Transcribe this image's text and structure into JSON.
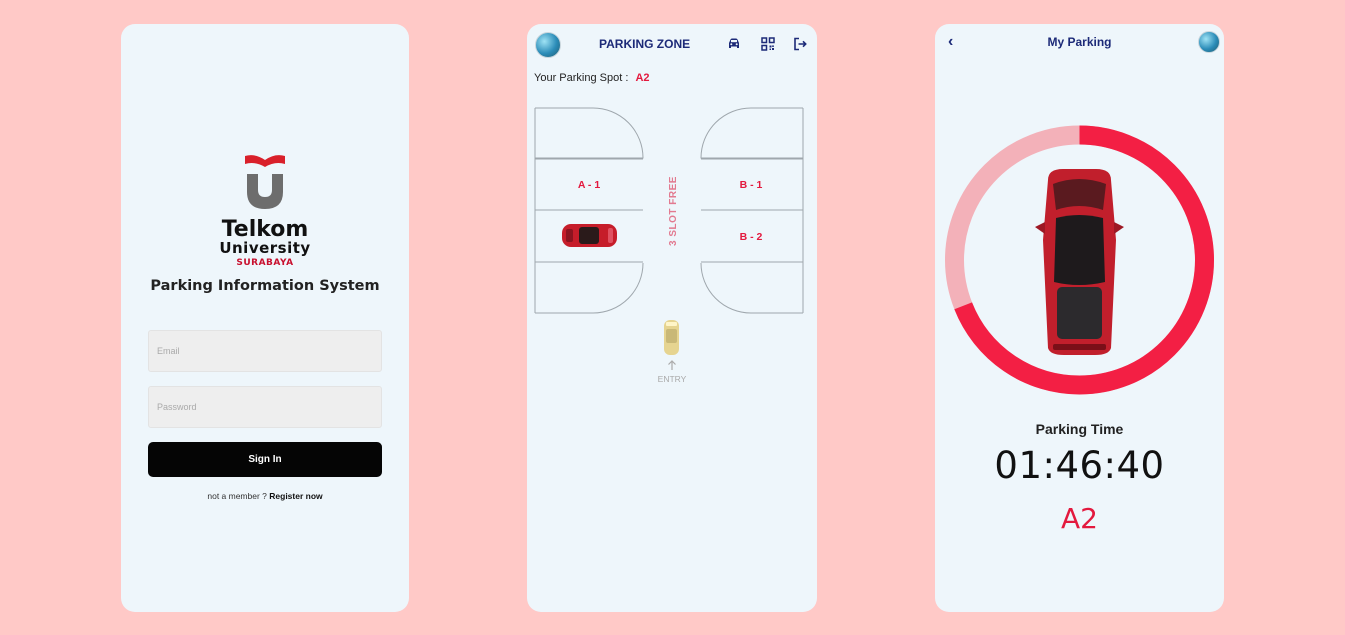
{
  "login": {
    "brand_line1": "Telkom",
    "brand_line2": "University",
    "brand_line3": "SURABAYA",
    "app_name": "Parking Information System",
    "email_placeholder": "Email",
    "password_placeholder": "Password",
    "sign_in_label": "Sign In",
    "not_member_text": "not a member ?",
    "register_link": "Register now"
  },
  "zone": {
    "title": "PARKING ZONE",
    "spot_label": "Your Parking Spot :",
    "spot_value": "A2",
    "slots": {
      "a1": "A - 1",
      "b1": "B - 1",
      "b2": "B - 2"
    },
    "free_text": "3 SLOT FREE",
    "entry_text": "ENTRY",
    "icons": [
      "car-icon",
      "qr-code-icon",
      "logout-icon"
    ]
  },
  "my_parking": {
    "title": "My Parking",
    "time_label": "Parking Time",
    "time_value": "01:46:40",
    "spot": "A2",
    "progress": 0.69
  },
  "colors": {
    "accent": "#e3193e",
    "navy": "#1c2a78",
    "background": "#ffc9c7",
    "card": "#eef6fb"
  }
}
